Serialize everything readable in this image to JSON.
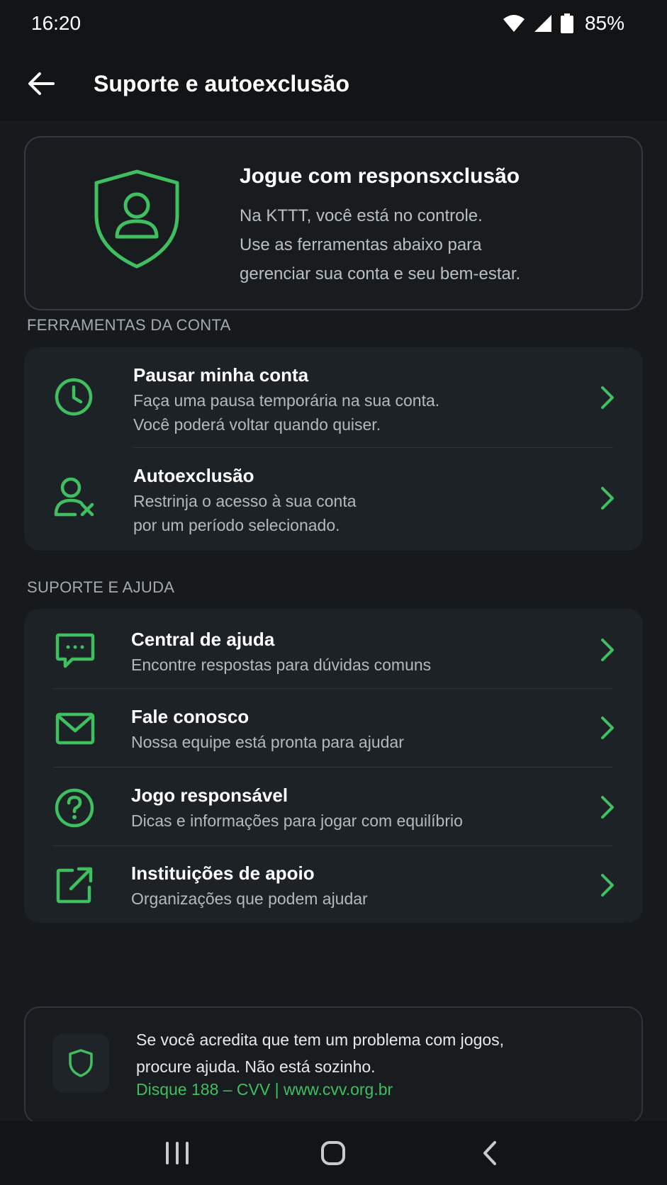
{
  "status_bar": {
    "time": "16:20",
    "battery": "85%"
  },
  "app_bar": {
    "title": "Suporte e autoexclusão"
  },
  "hero": {
    "title": "Jogue com responsxclusão",
    "lines": [
      "Na KTTT, você está no controle.",
      "Use as ferramentas abaixo para",
      "gerenciar sua conta e seu bem-estar."
    ]
  },
  "account_tools": {
    "label": "FERRAMENTAS DA CONTA",
    "items": [
      {
        "title": "Pausar minha conta",
        "desc1": "Faça uma pausa temporária na sua conta.",
        "desc2": "Você poderá voltar quando quiser.",
        "icon": "clock-icon"
      },
      {
        "title": "Autoexclusão",
        "desc1": "Restrinja o acesso à sua conta",
        "desc2": "por um período selecionado.",
        "icon": "user-x-icon"
      }
    ]
  },
  "support": {
    "label": "SUPORTE E AJUDA",
    "items": [
      {
        "title": "Central de ajuda",
        "desc": "Encontre respostas para dúvidas comuns",
        "icon": "chat-icon"
      },
      {
        "title": "Fale conosco",
        "desc": "Nossa equipe está pronta para ajudar",
        "icon": "mail-icon"
      },
      {
        "title": "Jogo responsável",
        "desc": "Dicas e informações para jogar com equilíbrio",
        "icon": "question-icon"
      },
      {
        "title": "Instituições de apoio",
        "desc": "Organizações que podem ajudar",
        "icon": "external-link-icon"
      }
    ]
  },
  "info": {
    "line1": "Se você acredita que tem um problema com jogos,",
    "line2": "procure ajuda. Não está sozinho.",
    "link": "Disque 188 – CVV | www.cvv.org.br"
  },
  "colors": {
    "accent": "#3fbf5f",
    "background": "#161a1d",
    "card": "#1d2226"
  }
}
